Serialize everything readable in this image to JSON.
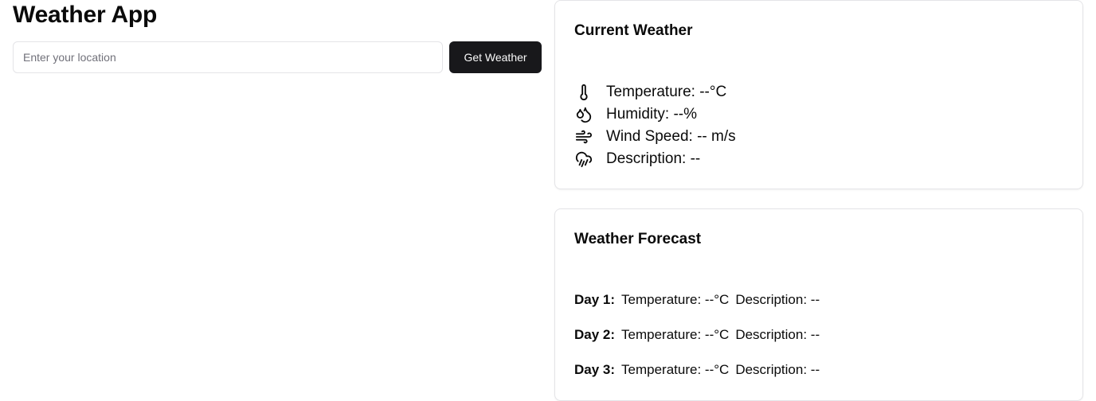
{
  "app": {
    "title": "Weather App"
  },
  "search": {
    "placeholder": "Enter your location",
    "value": "",
    "button_label": "Get Weather"
  },
  "current_weather": {
    "title": "Current Weather",
    "items": [
      {
        "icon": "thermometer-icon",
        "text": "Temperature: --°C"
      },
      {
        "icon": "droplets-icon",
        "text": "Humidity: --%"
      },
      {
        "icon": "wind-icon",
        "text": "Wind Speed: -- m/s"
      },
      {
        "icon": "cloud-rain-icon",
        "text": "Description: --"
      }
    ]
  },
  "forecast": {
    "title": "Weather Forecast",
    "days": [
      {
        "label": "Day 1:",
        "temperature": "Temperature: --°C",
        "description": "Description: --"
      },
      {
        "label": "Day 2:",
        "temperature": "Temperature: --°C",
        "description": "Description: --"
      },
      {
        "label": "Day 3:",
        "temperature": "Temperature: --°C",
        "description": "Description: --"
      }
    ]
  },
  "colors": {
    "button_bg": "#18181b",
    "button_text": "#fafafa",
    "border": "#e4e4e7",
    "text": "#0a0a0a",
    "placeholder": "#71717a"
  }
}
